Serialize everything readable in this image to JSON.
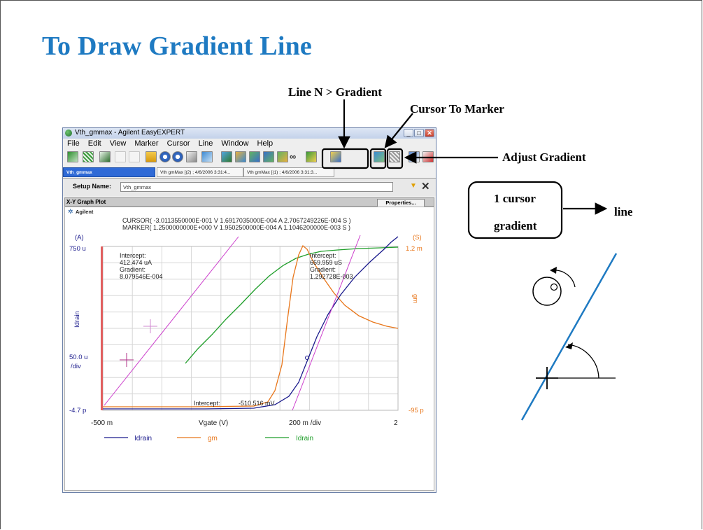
{
  "slide": {
    "title": "To Draw Gradient Line",
    "callouts": {
      "line_gradient": "Line N > Gradient",
      "cursor_to_marker": "Cursor To Marker",
      "adjust_gradient": "Adjust Gradient",
      "box_line1": "1 cursor",
      "box_line2": "gradient",
      "box_arrow_target": "line"
    }
  },
  "window": {
    "title": "Vth_gmmax - Agilent EasyEXPERT",
    "menus": [
      "File",
      "Edit",
      "View",
      "Marker",
      "Cursor",
      "Line",
      "Window",
      "Help"
    ],
    "tabs": [
      "Vth_gmmax",
      "Vth gmMax [(2) ; 4/6/2006 3:31:4...",
      "Vth gmMax [(1) ; 4/6/2006 3:31:3..."
    ],
    "setup_label": "Setup Name:",
    "setup_value": "Vth_gmmax",
    "panel_title": "X-Y Graph Plot",
    "properties_button": "Properties..."
  },
  "plot": {
    "brand": "Agilent",
    "cursor_readout": "CURSOR(  -3.0113550000E-001 V  1.6917035000E-004 A  2.7067249226E-004 S )",
    "marker_readout": "MARKER(  1.2500000000E+000 V  1.9502500000E-004 A  1.1046200000E-003 S )",
    "y1_unit": "(A)",
    "y2_unit": "(S)",
    "y1_top": "750 u",
    "y1_div": "50.0 u",
    "y1_div_suffix": "/div",
    "y1_bottom": "-4.7 p",
    "y1_label": "Idrain",
    "y2_top": "1.2 m",
    "y2_bottom": "-95 p",
    "y2_label": "gm",
    "x_min": "-500 m",
    "x_label": "Vgate  (V)",
    "x_div": "200 m /div",
    "x_max": "2",
    "intercept_left_label": "Intercept:",
    "intercept_left_value": "412.474 uA",
    "gradient_left_label": "Gradient:",
    "gradient_left_value": "8.079546E-004",
    "intercept_right_label": "Intercept:",
    "intercept_right_value": "659.959 uS",
    "gradient_right_label": "Gradient:",
    "gradient_right_value": "1.292728E-003",
    "intercept_bottom_label": "Intercept:",
    "intercept_bottom_value": "-510.516 mV",
    "legend": [
      "Idrain",
      "gm",
      "Idrain"
    ],
    "colors": {
      "idrain": "#1a1a8c",
      "gm": "#e8761a",
      "idrain2": "#1f9e2a",
      "gradient_line": "#cc3fcc",
      "grid": "#d6d6d6",
      "accent": "#1e7ac2"
    }
  }
}
